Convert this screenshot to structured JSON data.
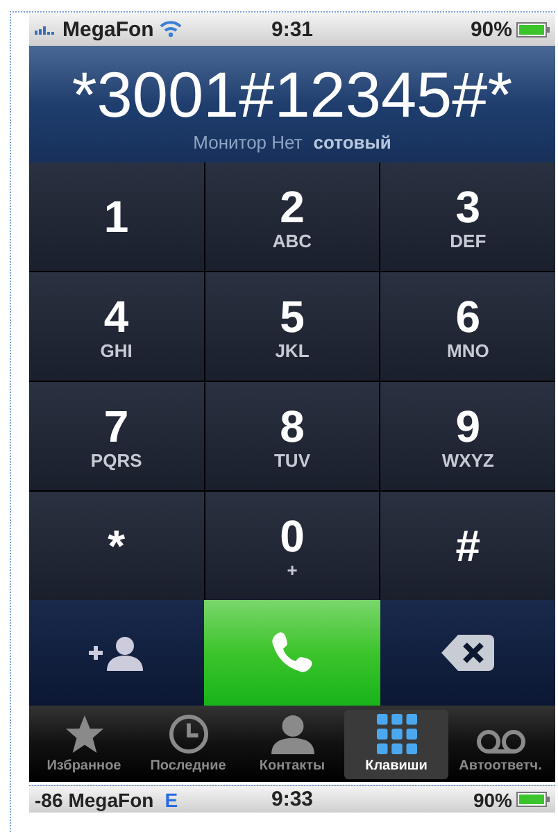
{
  "status_bar": {
    "carrier": "MegaFon",
    "time": "9:31",
    "battery": "90%"
  },
  "display": {
    "number": "*3001#12345#*",
    "line": "Монитор Нет",
    "line_label": "сотовый"
  },
  "keys": [
    {
      "digit": "1"
    },
    {
      "digit": "2",
      "letters": "ABC"
    },
    {
      "digit": "3",
      "letters": "DEF"
    },
    {
      "digit": "4",
      "letters": "GHI"
    },
    {
      "digit": "5",
      "letters": "JKL"
    },
    {
      "digit": "6",
      "letters": "MNO"
    },
    {
      "digit": "7",
      "letters": "PQRS"
    },
    {
      "digit": "8",
      "letters": "TUV"
    },
    {
      "digit": "9",
      "letters": "WXYZ"
    },
    {
      "digit": "*"
    },
    {
      "digit": "0",
      "letters": "+"
    },
    {
      "digit": "#"
    }
  ],
  "tabs": [
    {
      "label": "Избранное",
      "kind": "star",
      "selected": false
    },
    {
      "label": "Последние",
      "kind": "clock",
      "selected": false
    },
    {
      "label": "Контакты",
      "kind": "person",
      "selected": false
    },
    {
      "label": "Клавиши",
      "kind": "keypad",
      "selected": true
    },
    {
      "label": "Автоответч.",
      "kind": "voicemail",
      "selected": false
    }
  ],
  "next_status_bar": {
    "signal": "-86",
    "carrier": "MegaFon",
    "network": "E",
    "time": "9:33",
    "battery": "90%"
  }
}
